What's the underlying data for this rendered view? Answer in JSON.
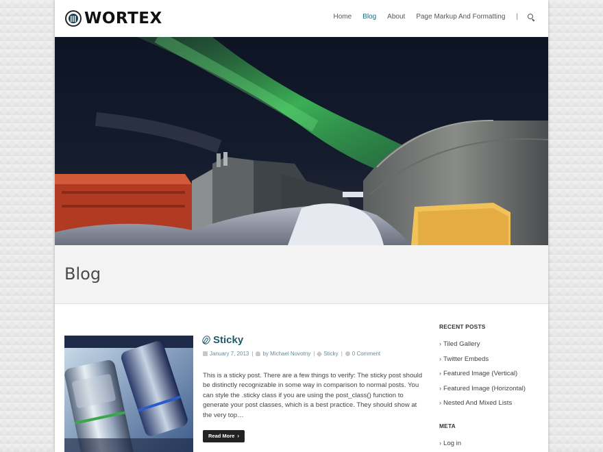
{
  "header": {
    "logo_text": "WORTEX",
    "nav": [
      "Home",
      "Blog",
      "About",
      "Page Markup And Formatting"
    ],
    "nav_separator": "|",
    "active_nav": "Blog",
    "accent_color": "#1a6a7a"
  },
  "page": {
    "title": "Blog"
  },
  "post": {
    "title": "Sticky",
    "title_icon": "paperclip-icon",
    "date": "January 7, 2013",
    "author": "by Michael Novotny",
    "category": "Sticky",
    "comments": "0 Comment",
    "meta_sep": "|",
    "excerpt": "This is a sticky post. There are a few things to verify: The sticky post should be distinctly recognizable in some way in comparison to normal posts. You can style the .sticky class if you are using the post_class() function to generate your post classes, which is a best practice. They should show at the very top…",
    "read_more": "Read More",
    "read_more_chevron": "›"
  },
  "sidebar": {
    "recent_posts_title": "RECENT POSTS",
    "recent_posts": [
      "Tiled Gallery",
      "Twitter Embeds",
      "Featured Image (Vertical)",
      "Featured Image (Horizontal)",
      "Nested And Mixed Lists"
    ],
    "meta_title": "META",
    "meta_items": [
      "Log in"
    ],
    "chevron": "›"
  }
}
